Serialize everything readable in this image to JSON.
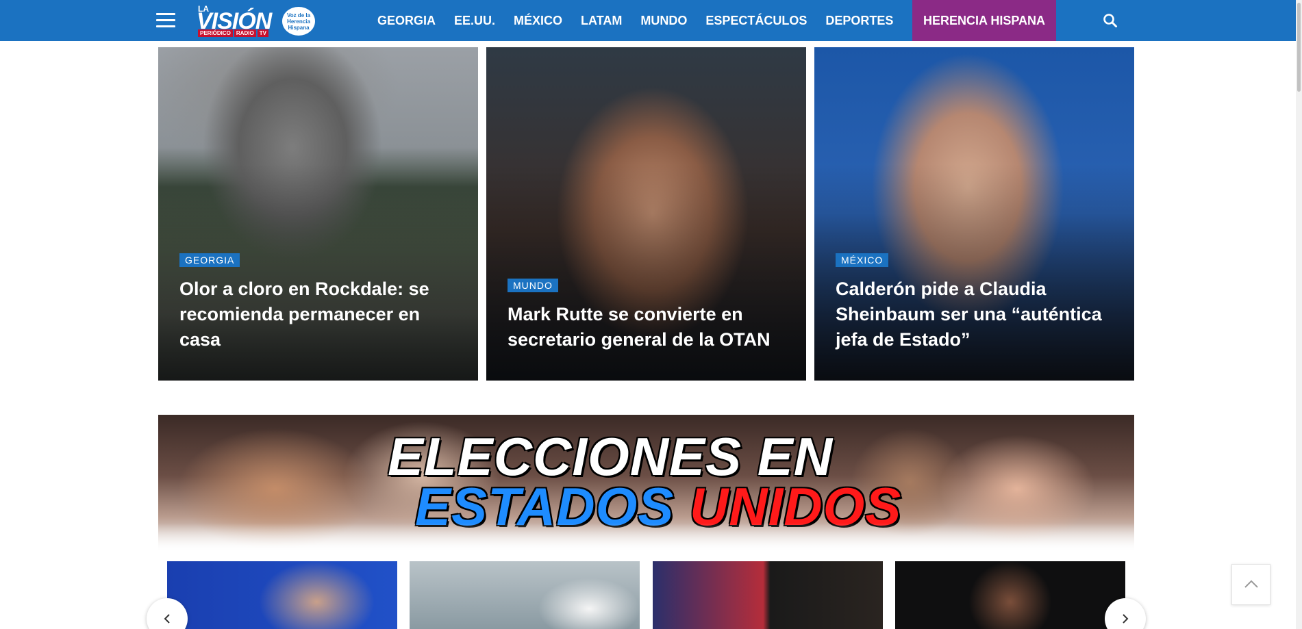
{
  "header": {
    "logo": {
      "la": "LA",
      "vision": "VISIÓN",
      "strip": [
        "PERIÓDICO",
        "RADIO",
        "TV"
      ],
      "badge": "Voz de la Herencia Hispana"
    },
    "nav": [
      {
        "label": "GEORGIA"
      },
      {
        "label": "EE.UU."
      },
      {
        "label": "MÉXICO"
      },
      {
        "label": "LATAM"
      },
      {
        "label": "MUNDO"
      },
      {
        "label": "ESPECTÁCULOS"
      },
      {
        "label": "DEPORTES"
      }
    ],
    "highlight": "HERENCIA HISPANA",
    "colors": {
      "bar": "#1b72c1",
      "highlight": "#8b2a86"
    }
  },
  "featured": [
    {
      "category": "GEORGIA",
      "title": "Olor a cloro en Rockdale: se recomienda permanecer en casa"
    },
    {
      "category": "MUNDO",
      "title": "Mark Rutte se convierte en secretario general de la OTAN"
    },
    {
      "category": "MÉXICO",
      "title": "Calderón pide a Claudia Sheinbaum ser una “auténtica jefa de Estado”"
    }
  ],
  "banner": {
    "line1": "ELECCIONES EN",
    "line2_blue": "ESTADOS",
    "line2_red": "UNIDOS"
  }
}
